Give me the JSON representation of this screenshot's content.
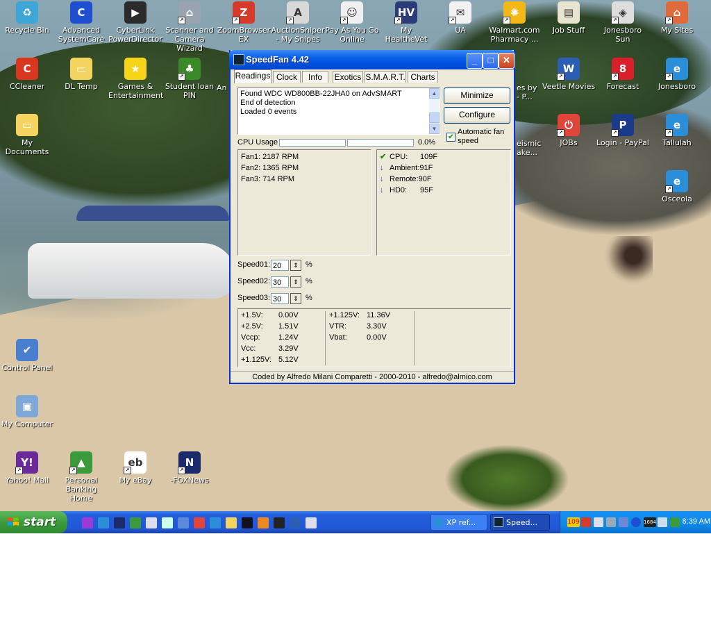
{
  "desktop": {
    "icons": [
      {
        "name": "recycle-bin-icon",
        "label": "Recycle Bin",
        "color": "#3fa7d8",
        "glyph": "♻"
      },
      {
        "name": "advanced-systemcare-icon",
        "label": "Advanced SystemCare",
        "color": "#1f4fd1",
        "glyph": "C"
      },
      {
        "name": "cyberlink-powerdirector-icon",
        "label": "CyberLink PowerDirector",
        "color": "#2b2b2b",
        "glyph": "▶"
      },
      {
        "name": "scanner-camera-wizard-icon",
        "label": "Scanner and Camera Wizard",
        "color": "#9aa4b0",
        "glyph": "⌂"
      },
      {
        "name": "zoombrowser-ex-icon",
        "label": "ZoomBrowser EX",
        "color": "#d63a2a",
        "glyph": "Z"
      },
      {
        "name": "auctionsniper-icon",
        "label": "AuctionSniper - My Snipes",
        "color": "#d8d8d8",
        "glyph": "A"
      },
      {
        "name": "pay-as-you-go-icon",
        "label": "Pay As You Go Online",
        "color": "#f0f0f0",
        "glyph": "☺"
      },
      {
        "name": "my-healthevet-icon",
        "label": "My HealtheVet",
        "color": "#2a3d7a",
        "glyph": "HV"
      },
      {
        "name": "ua-icon",
        "label": "UA",
        "color": "#f2f2f2",
        "glyph": "✉"
      },
      {
        "name": "walmart-pharmacy-icon",
        "label": "Walmart.com Pharmacy ...",
        "color": "#f3b718",
        "glyph": "✺"
      },
      {
        "name": "job-stuff-icon",
        "label": "Job Stuff",
        "color": "#e8e4d0",
        "glyph": "▤"
      },
      {
        "name": "jonesboro-sun-icon",
        "label": "Jonesboro Sun",
        "color": "#dddddd",
        "glyph": "◈"
      },
      {
        "name": "my-sites-icon",
        "label": "My Sites",
        "color": "#e06a3a",
        "glyph": "⌂"
      },
      {
        "name": "ccleaner-icon",
        "label": "CCleaner",
        "color": "#d8361f",
        "glyph": "C"
      },
      {
        "name": "dl-temp-icon",
        "label": "DL Temp",
        "color": "#f4d35e",
        "glyph": "▭"
      },
      {
        "name": "games-entertainment-icon",
        "label": "Games & Entertainment",
        "color": "#f7d417",
        "glyph": "★"
      },
      {
        "name": "student-loan-pin-icon",
        "label": "Student loan PIN",
        "color": "#3b8a2a",
        "glyph": "♣"
      },
      {
        "name": "veetle-movies-icon",
        "label": "Veetle Movies",
        "color": "#2b5db5",
        "glyph": "W"
      },
      {
        "name": "forecast-icon",
        "label": "Forecast",
        "color": "#d81f2a",
        "glyph": "8"
      },
      {
        "name": "jonesboro-icon",
        "label": "Jonesboro",
        "color": "#2a8fd8",
        "glyph": "e"
      },
      {
        "name": "my-documents-icon",
        "label": "My Documents",
        "color": "#f4d35e",
        "glyph": "▭"
      },
      {
        "name": "jobs-icon",
        "label": "JOBs",
        "color": "#e0443a",
        "glyph": "⏻"
      },
      {
        "name": "login-paypal-icon",
        "label": "Login - PayPal",
        "color": "#1a3a8a",
        "glyph": "P"
      },
      {
        "name": "tallulah-icon",
        "label": "Tallulah",
        "color": "#2a8fd8",
        "glyph": "e"
      },
      {
        "name": "osceola-icon",
        "label": "Osceola",
        "color": "#2a8fd8",
        "glyph": "e"
      },
      {
        "name": "control-panel-icon",
        "label": "Control Panel",
        "color": "#4a7fd0",
        "glyph": "✔"
      },
      {
        "name": "my-computer-icon",
        "label": "My Computer",
        "color": "#7fa8d8",
        "glyph": "▣"
      },
      {
        "name": "yahoo-mail-icon",
        "label": "Yahoo! Mail",
        "color": "#6b2a9a",
        "glyph": "Y!"
      },
      {
        "name": "personal-banking-home-icon",
        "label": "Personal Banking Home",
        "color": "#3b9a3b",
        "glyph": "▲"
      },
      {
        "name": "my-ebay-icon",
        "label": "My eBay",
        "color": "#ffffff",
        "glyph": "eb"
      },
      {
        "name": "foxnews-icon",
        "label": "-FOXNews",
        "color": "#1a2a6a",
        "glyph": "N"
      }
    ],
    "partial_labels": {
      "an": "An",
      "es_by": "es by",
      "p_dots": "- P...",
      "seismic": "eismic",
      "make": "ake..."
    }
  },
  "window": {
    "title": "SpeedFan 4.42",
    "buttons": {
      "minimize": "_",
      "maximize": "□",
      "close": "✕"
    },
    "tabs": [
      "Readings",
      "Clock",
      "Info",
      "Exotics",
      "S.M.A.R.T.",
      "Charts"
    ],
    "active_tab": "Readings",
    "log_lines": [
      "Found WDC WD800BB-22JHA0 on AdvSMART",
      "End of detection",
      "Loaded 0 events"
    ],
    "minimize_button": "Minimize",
    "configure_button": "Configure",
    "auto_fan_label": "Automatic fan speed",
    "auto_fan_checked": true,
    "cpu_usage_label": "CPU Usage",
    "cpu_usage_value": "0.0%",
    "fans": [
      "Fan1: 2187 RPM",
      "Fan2: 1365 RPM",
      "Fan3: 714 RPM"
    ],
    "temps": [
      {
        "icon": "check-icon",
        "label": "CPU:",
        "value": "109F",
        "color": "#1a8a1a"
      },
      {
        "icon": "arrow-down-icon",
        "label": "Ambient:",
        "value": "91F",
        "color": "#1a3ad8"
      },
      {
        "icon": "arrow-down-icon",
        "label": "Remote:",
        "value": "90F",
        "color": "#1a3ad8"
      },
      {
        "icon": "arrow-down-icon",
        "label": "HD0:",
        "value": "95F",
        "color": "#1a3ad8"
      }
    ],
    "speeds": [
      {
        "label": "Speed01:",
        "value": "20",
        "unit": "%"
      },
      {
        "label": "Speed02:",
        "value": "30",
        "unit": "%"
      },
      {
        "label": "Speed03:",
        "value": "30",
        "unit": "%"
      }
    ],
    "voltages_left": [
      {
        "label": "+1.5V:",
        "value": "0.00V"
      },
      {
        "label": "+2.5V:",
        "value": "1.51V"
      },
      {
        "label": "Vccp:",
        "value": "1.24V"
      },
      {
        "label": "Vcc:",
        "value": "3.29V"
      },
      {
        "label": "+1.125V:",
        "value": "5.12V"
      }
    ],
    "voltages_right": [
      {
        "label": "+1.125V:",
        "value": "11.36V"
      },
      {
        "label": "VTR:",
        "value": "3.30V"
      },
      {
        "label": "Vbat:",
        "value": "0.00V"
      }
    ],
    "footer": "Coded by Alfredo Milani Comparetti - 2000-2010 - alfredo@almico.com"
  },
  "taskbar": {
    "start_label": "start",
    "tasks": [
      {
        "label": "XP ref...",
        "active": false
      },
      {
        "label": "Speed...",
        "active": true
      }
    ],
    "tray_text": {
      "badge": "109",
      "counter": "1684"
    },
    "clock": "8:39 AM"
  }
}
